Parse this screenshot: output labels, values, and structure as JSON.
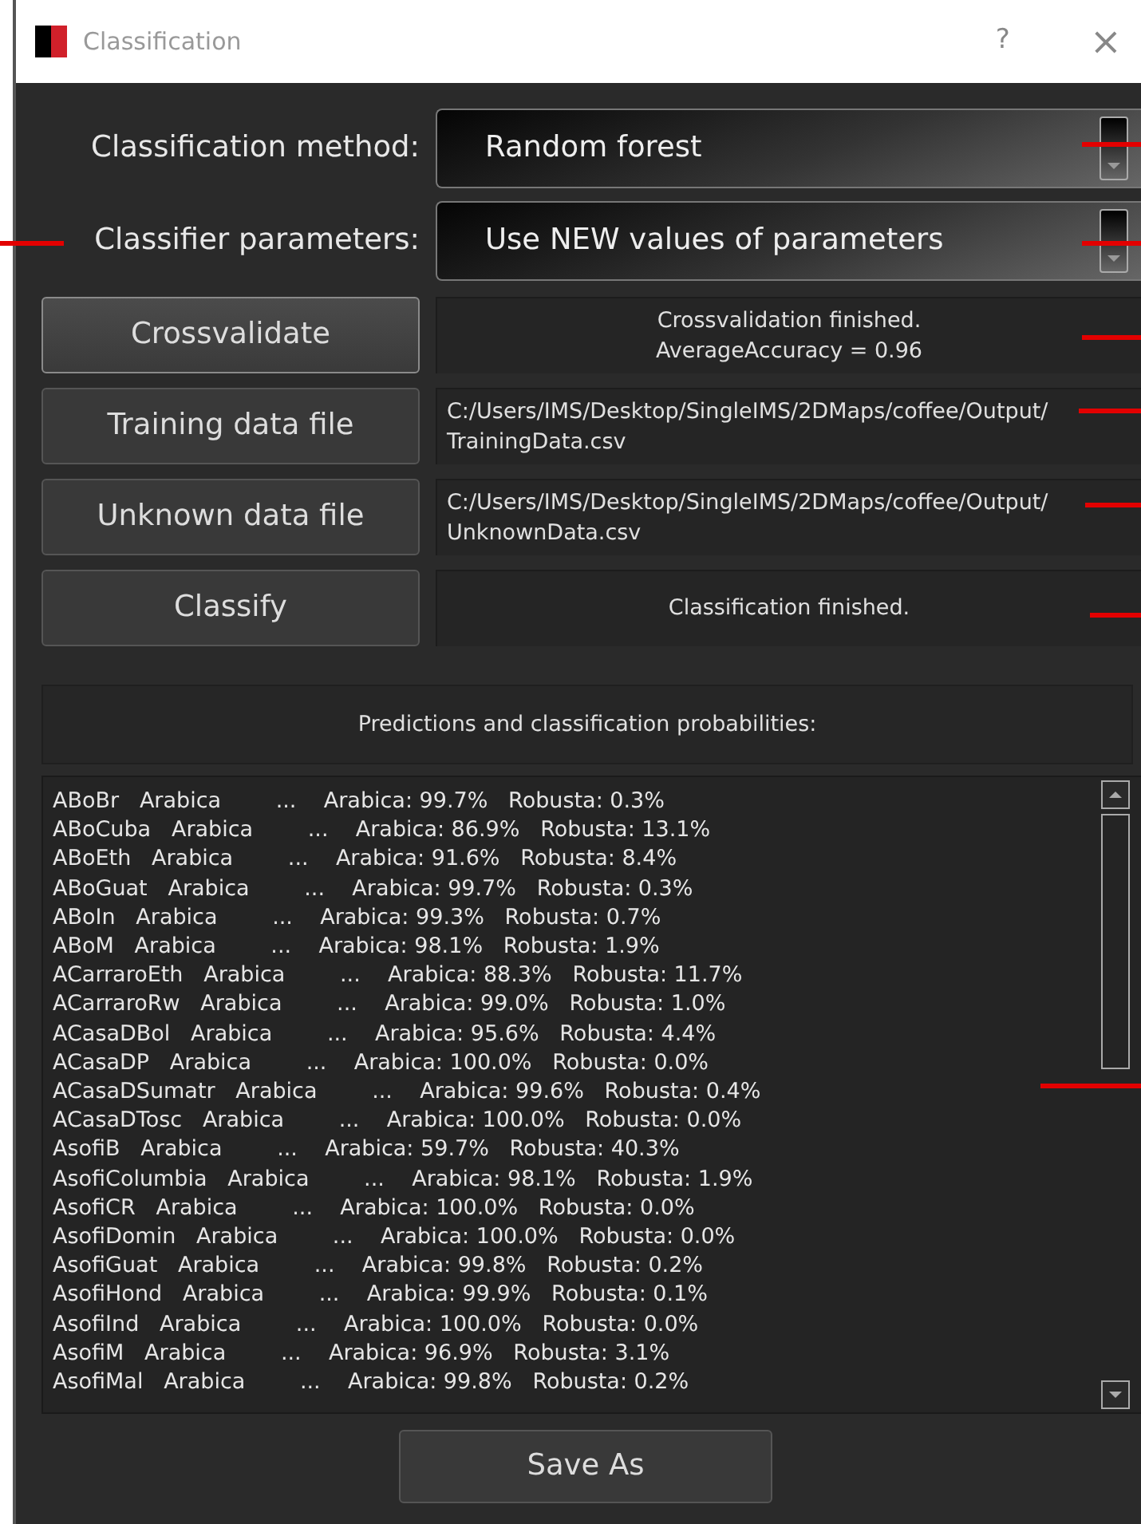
{
  "window": {
    "title": "Classification",
    "help": "?",
    "close": "×"
  },
  "settings": [
    {
      "label": "Classification method:",
      "value": "Random forest"
    },
    {
      "label": "Classifier parameters:",
      "value": "Use NEW values of parameters"
    }
  ],
  "actions": [
    {
      "button": "Crossvalidate",
      "default": true,
      "kind": "status",
      "output": "Crossvalidation finished.\nAverageAccuracy = 0.96"
    },
    {
      "button": "Training data file",
      "default": false,
      "kind": "path",
      "output": "C:/Users/IMS/Desktop/SingleIMS/2DMaps/coffee/Output/\nTrainingData.csv"
    },
    {
      "button": "Unknown data file",
      "default": false,
      "kind": "path",
      "output": "C:/Users/IMS/Desktop/SingleIMS/2DMaps/coffee/Output/\nUnknownData.csv"
    },
    {
      "button": "Classify",
      "default": false,
      "kind": "status",
      "output": "Classification finished."
    }
  ],
  "results": {
    "heading": "Predictions and classification probabilities:",
    "lines": [
      "ABoBr   Arabica        ...    Arabica: 99.7%   Robusta: 0.3%",
      "ABoCuba   Arabica        ...    Arabica: 86.9%   Robusta: 13.1%",
      "ABoEth   Arabica        ...    Arabica: 91.6%   Robusta: 8.4%",
      "ABoGuat   Arabica        ...    Arabica: 99.7%   Robusta: 0.3%",
      "ABoIn   Arabica        ...    Arabica: 99.3%   Robusta: 0.7%",
      "ABoM   Arabica        ...    Arabica: 98.1%   Robusta: 1.9%",
      "ACarraroEth   Arabica        ...    Arabica: 88.3%   Robusta: 11.7%",
      "ACarraroRw   Arabica        ...    Arabica: 99.0%   Robusta: 1.0%",
      "ACasaDBol   Arabica        ...    Arabica: 95.6%   Robusta: 4.4%",
      "ACasaDP   Arabica        ...    Arabica: 100.0%   Robusta: 0.0%",
      "ACasaDSumatr   Arabica        ...    Arabica: 99.6%   Robusta: 0.4%",
      "ACasaDTosc   Arabica        ...    Arabica: 100.0%   Robusta: 0.0%",
      "AsofiB   Arabica        ...    Arabica: 59.7%   Robusta: 40.3%",
      "AsofiColumbia   Arabica        ...    Arabica: 98.1%   Robusta: 1.9%",
      "AsofiCR   Arabica        ...    Arabica: 100.0%   Robusta: 0.0%",
      "AsofiDomin   Arabica        ...    Arabica: 100.0%   Robusta: 0.0%",
      "AsofiGuat   Arabica        ...    Arabica: 99.8%   Robusta: 0.2%",
      "AsofiHond   Arabica        ...    Arabica: 99.9%   Robusta: 0.1%",
      "AsofiInd   Arabica        ...    Arabica: 100.0%   Robusta: 0.0%",
      "AsofiM   Arabica        ...    Arabica: 96.9%   Robusta: 3.1%",
      "AsofiMal   Arabica        ...    Arabica: 99.8%   Robusta: 0.2%"
    ]
  },
  "save_button": "Save As"
}
